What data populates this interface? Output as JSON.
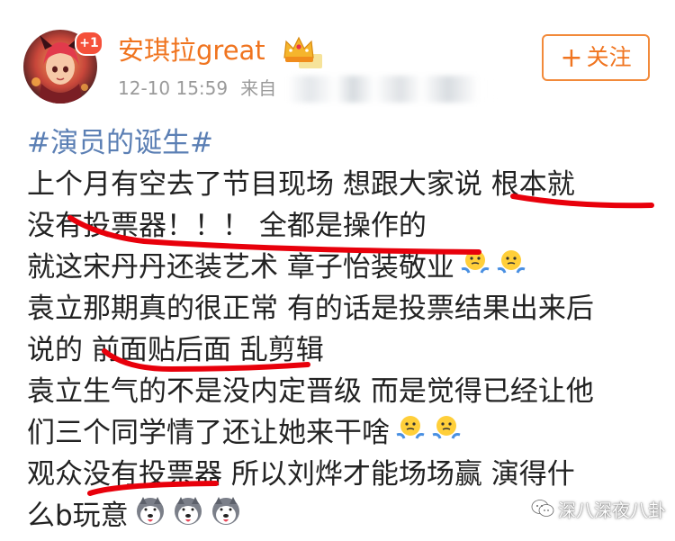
{
  "post": {
    "author": {
      "name": "安琪拉great",
      "badge": "+1",
      "avatar_icon": "avatar-image",
      "crown_icon": "crown-vip-icon"
    },
    "meta": {
      "time": "12-10 15:59",
      "source": "来自"
    },
    "follow_button": {
      "plus": "+",
      "label": "关注"
    },
    "body": {
      "topic": "#演员的诞生#",
      "lines": [
        "上个月有空去了节目现场 想跟大家说 根本就",
        "没有投票器！！！ 全都是操作的",
        "就这宋丹丹还装艺术 章子怡装敬业",
        "袁立那期真的很正常 有的话是投票结果出来后",
        "说的 前面贴后面 乱剪辑",
        "袁立生气的不是没内定晋级 而是觉得已经让他",
        "们三个同学情了还让她来干啥",
        "观众没有投票器 所以刘烨才能场场赢 演得什",
        "么b玩意"
      ]
    },
    "watermark": "深八深夜八卦"
  },
  "colors": {
    "username": "#f0741f",
    "topic": "#5b7fb4",
    "follow_border": "#f28a3a",
    "annotation": "#e8000b",
    "meta": "#9a9a9a"
  }
}
